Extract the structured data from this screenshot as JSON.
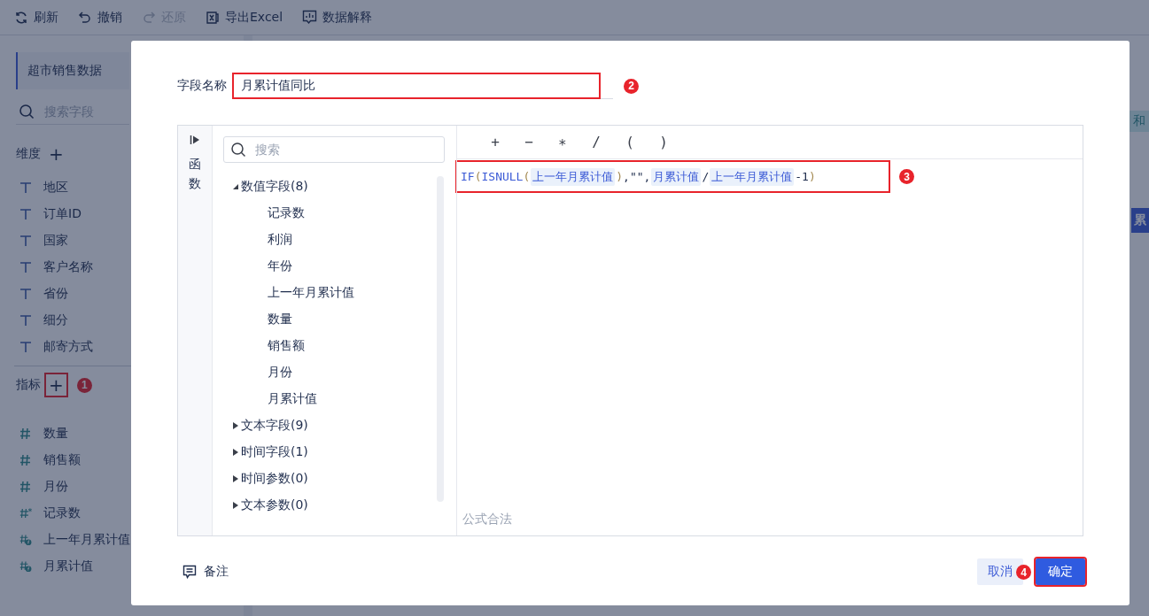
{
  "toolbar": [
    {
      "kind": "refresh",
      "label": "刷新",
      "disabled": false
    },
    {
      "kind": "undo",
      "label": "撤销",
      "disabled": false
    },
    {
      "kind": "redo",
      "label": "还原",
      "disabled": true
    },
    {
      "kind": "excel",
      "label": "导出Excel",
      "disabled": false
    },
    {
      "kind": "explain",
      "label": "数据解释",
      "disabled": false
    }
  ],
  "sidebar": {
    "dataset": "超市销售数据",
    "search_placeholder": "搜索字段",
    "dimensions": {
      "title": "维度",
      "add": "+",
      "items": [
        {
          "kind": "text",
          "label": "地区"
        },
        {
          "kind": "text",
          "label": "订单ID"
        },
        {
          "kind": "text",
          "label": "国家"
        },
        {
          "kind": "text",
          "label": "客户名称"
        },
        {
          "kind": "text",
          "label": "省份"
        },
        {
          "kind": "text",
          "label": "细分"
        },
        {
          "kind": "text",
          "label": "邮寄方式"
        }
      ]
    },
    "measures": {
      "title": "指标",
      "add": "+",
      "add_highlighted": true,
      "badge": "1",
      "items": [
        {
          "kind": "number",
          "label": "数量"
        },
        {
          "kind": "number",
          "label": "销售额"
        },
        {
          "kind": "number",
          "label": "月份"
        },
        {
          "kind": "count",
          "label": "记录数"
        },
        {
          "kind": "calculated",
          "label": "上一年月累计值"
        },
        {
          "kind": "calculated",
          "label": "月累计值"
        }
      ]
    }
  },
  "background": {
    "tag": "和",
    "column_header": "累"
  },
  "dialog": {
    "field_name": {
      "label": "字段名称",
      "value": "月累计值同比",
      "highlighted": true,
      "badge": "2"
    },
    "side_tab": "函数",
    "search_placeholder": "搜索",
    "tree": [
      {
        "label": "数值字段(8)",
        "expanded": true,
        "children": [
          {
            "label": "记录数"
          },
          {
            "label": "利润"
          },
          {
            "label": "年份"
          },
          {
            "label": "上一年月累计值"
          },
          {
            "label": "数量"
          },
          {
            "label": "销售额"
          },
          {
            "label": "月份"
          },
          {
            "label": "月累计值"
          }
        ]
      },
      {
        "label": "文本字段(9)",
        "expanded": false
      },
      {
        "label": "时间字段(1)",
        "expanded": false
      },
      {
        "label": "时间参数(0)",
        "expanded": false
      },
      {
        "label": "文本参数(0)",
        "expanded": false
      }
    ],
    "operators": [
      "+",
      "−",
      "∗",
      "/",
      "(",
      ")"
    ],
    "formula": {
      "highlighted": true,
      "badge": "3",
      "tokens": [
        {
          "kind": "function",
          "text": "IF"
        },
        {
          "kind": "paren",
          "text": "("
        },
        {
          "kind": "function",
          "text": "ISNULL"
        },
        {
          "kind": "paren",
          "text": "("
        },
        {
          "kind": "field",
          "text": "上一年月累计值"
        },
        {
          "kind": "paren",
          "text": ")"
        },
        {
          "kind": "plain",
          "text": ",\"\","
        },
        {
          "kind": "field",
          "text": "月累计值"
        },
        {
          "kind": "plain",
          "text": "/"
        },
        {
          "kind": "field",
          "text": "上一年月累计值"
        },
        {
          "kind": "plain",
          "text": "-1"
        },
        {
          "kind": "paren",
          "text": ")"
        }
      ]
    },
    "status": "公式合法",
    "note": "备注",
    "cancel": "取消",
    "confirm": {
      "label": "确定",
      "highlighted": true,
      "badge": "4"
    }
  }
}
